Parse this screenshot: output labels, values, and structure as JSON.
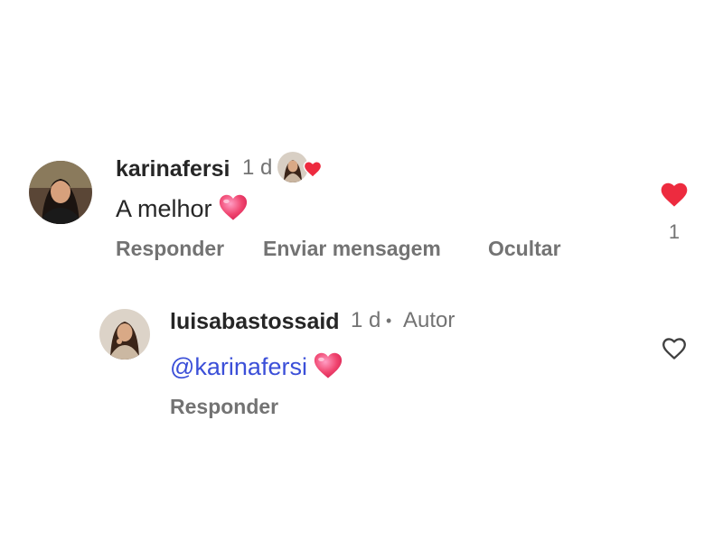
{
  "comments": [
    {
      "username": "karinafersi",
      "time": "1 d",
      "text": "A melhor",
      "emoji": "pink-heart",
      "actions": [
        "Responder",
        "Enviar mensagem",
        "Ocultar"
      ],
      "like_icon": "heart-filled-icon",
      "like_color": "#ed2b3f",
      "likes": "1",
      "liked_by_author_icon": "red-heart-icon"
    }
  ],
  "reply": {
    "username": "luisabastossaid",
    "time": "1 d",
    "separator": "•",
    "badge": "Autor",
    "mention": "@karinafersi",
    "emoji": "pink-heart",
    "actions": [
      "Responder"
    ],
    "like_icon": "heart-outline-icon"
  },
  "colors": {
    "text_primary": "#262626",
    "text_secondary": "#737373",
    "mention": "#3b4fd8",
    "like_red": "#ed2b3f"
  }
}
